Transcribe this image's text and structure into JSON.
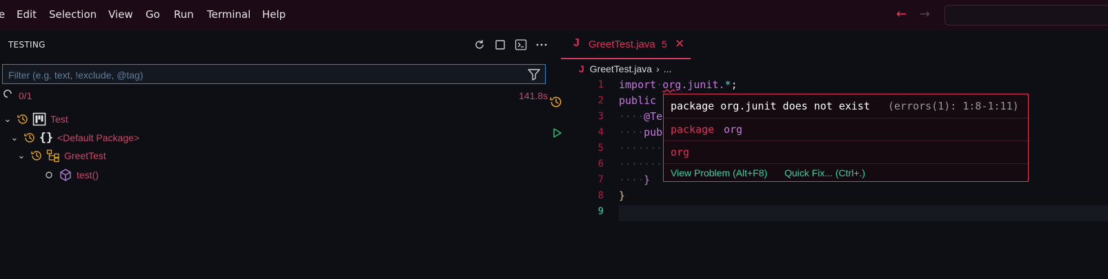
{
  "menu": {
    "items": [
      "e",
      "Edit",
      "Selection",
      "View",
      "Go",
      "Run",
      "Terminal",
      "Help"
    ]
  },
  "sidebar": {
    "title": "TESTING",
    "filter_placeholder": "Filter (e.g. text, !exclude, @tag)",
    "progress": "0/1",
    "duration": "141.8s",
    "tree": [
      {
        "label": "Test",
        "icon": "test-project-icon"
      },
      {
        "label": "<Default Package>",
        "icon": "braces-icon"
      },
      {
        "label": "GreetTest",
        "icon": "class-icon"
      },
      {
        "label": "test()",
        "icon": "method-icon"
      }
    ]
  },
  "editor": {
    "tab": {
      "name": "GreetTest.java",
      "problems": "5",
      "icon_letter": "J"
    },
    "breadcrumb": {
      "file": "GreetTest.java",
      "more": "..."
    },
    "line_numbers": [
      "1",
      "2",
      "3",
      "4",
      "5",
      "6",
      "7",
      "8",
      "9"
    ],
    "code": {
      "l1_kw": "import",
      "l1_pkg": "org",
      "l1_rest": ".junit.",
      "l1_star": "*",
      "l1_semi": ";",
      "l2_kw": "public",
      "l3_ann": "@Te",
      "l4_kw": "publ",
      "l7_brace": "}",
      "l8_brace": "}"
    }
  },
  "hover": {
    "message": "package org.junit does not exist",
    "code": "(errors(1): 1:8-1:11)",
    "row2_kw": "package",
    "row2_name": "org",
    "row3": "org",
    "view_problem": "View Problem (Alt+F8)",
    "quick_fix": "Quick Fix... (Ctrl+.)"
  },
  "colors": {
    "accent": "#e0305a",
    "keyword": "#c678dd",
    "link": "#2fd6a5",
    "history": "#e5a823"
  }
}
